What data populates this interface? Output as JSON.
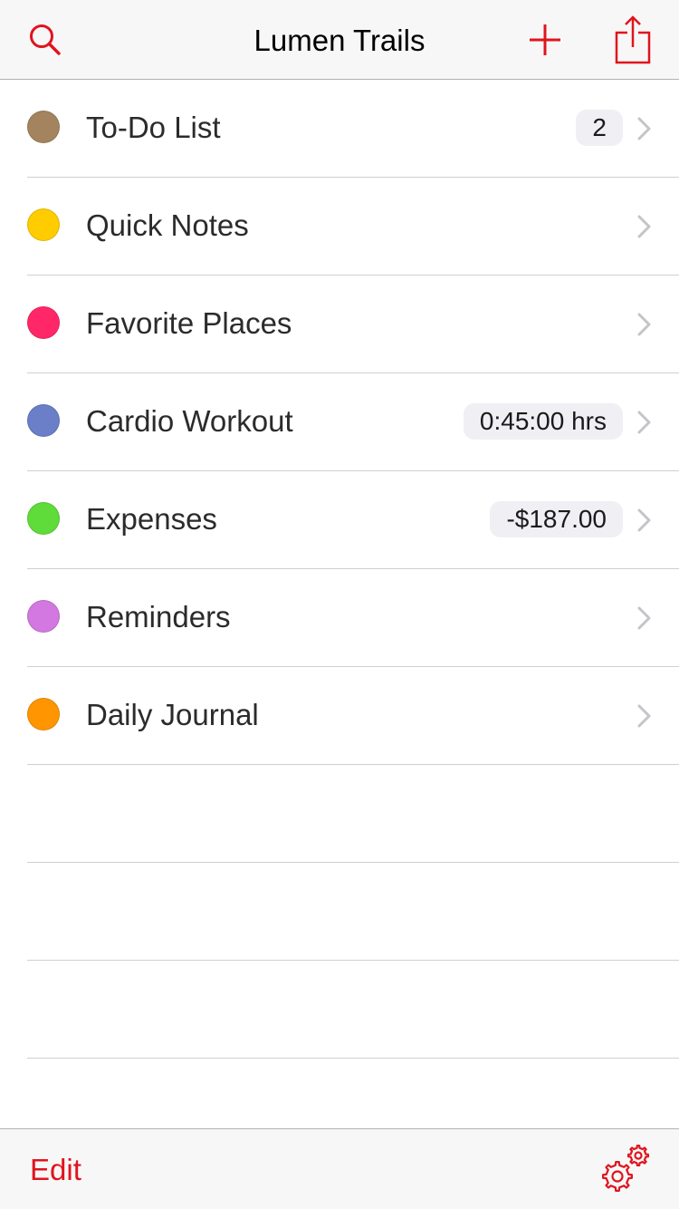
{
  "colors": {
    "accent": "#e0141e",
    "nav_background": "#f7f7f7"
  },
  "navbar": {
    "title": "Lumen Trails",
    "left_icon": "search-icon",
    "right_icons": [
      "plus-icon",
      "share-icon"
    ]
  },
  "list": {
    "items": [
      {
        "label": "To-Do List",
        "color": "#a3845e",
        "badge": "2"
      },
      {
        "label": "Quick Notes",
        "color": "#ffcc00",
        "badge": null
      },
      {
        "label": "Favorite Places",
        "color": "#ff2768",
        "badge": null
      },
      {
        "label": "Cardio Workout",
        "color": "#6a7fc7",
        "badge": "0:45:00 hrs"
      },
      {
        "label": "Expenses",
        "color": "#5fdb3a",
        "badge": "-$187.00"
      },
      {
        "label": "Reminders",
        "color": "#d378e0",
        "badge": null
      },
      {
        "label": "Daily Journal",
        "color": "#ff9500",
        "badge": null
      }
    ]
  },
  "toolbar": {
    "edit_label": "Edit",
    "settings_icon": "gears-icon"
  }
}
